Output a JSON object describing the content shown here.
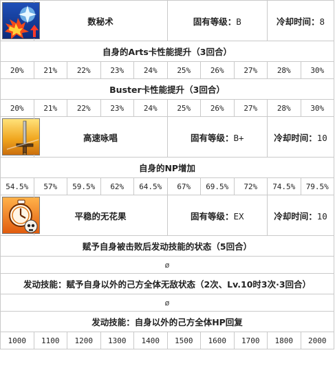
{
  "skills": [
    {
      "icon": "magic-burst-icon",
      "name": "数秘术",
      "rank_label": "固有等级：",
      "rank": "B",
      "cd_label": "冷却时间：",
      "cd": "8",
      "effects": [
        {
          "text": "自身的Arts卡性能提升（3回合）",
          "values": [
            "20%",
            "21%",
            "22%",
            "23%",
            "24%",
            "25%",
            "26%",
            "27%",
            "28%",
            "30%"
          ]
        },
        {
          "text": "Buster卡性能提升（3回合）",
          "values": [
            "20%",
            "21%",
            "22%",
            "23%",
            "24%",
            "25%",
            "26%",
            "27%",
            "28%",
            "30%"
          ]
        }
      ]
    },
    {
      "icon": "sword-icon",
      "name": "高速咏唱",
      "rank_label": "固有等级：",
      "rank": "B+",
      "cd_label": "冷却时间：",
      "cd": "10",
      "effects": [
        {
          "text": "自身的NP增加",
          "values": [
            "54.5%",
            "57%",
            "59.5%",
            "62%",
            "64.5%",
            "67%",
            "69.5%",
            "72%",
            "74.5%",
            "79.5%"
          ]
        }
      ]
    },
    {
      "icon": "timer-skull-icon",
      "name": "平稳的无花果",
      "rank_label": "固有等级：",
      "rank": "EX",
      "cd_label": "冷却时间：",
      "cd": "10",
      "effects": [
        {
          "text": "赋予自身被击败后发动技能的状态（5回合）",
          "single": "ø"
        },
        {
          "text": "发动技能：赋予自身以外的己方全体无敌状态（2次、Lv.10时3次·3回合）",
          "single": "ø"
        },
        {
          "text": "发动技能：自身以外的己方全体HP回复",
          "values": [
            "1000",
            "1100",
            "1200",
            "1300",
            "1400",
            "1500",
            "1600",
            "1700",
            "1800",
            "2000"
          ]
        }
      ]
    }
  ]
}
